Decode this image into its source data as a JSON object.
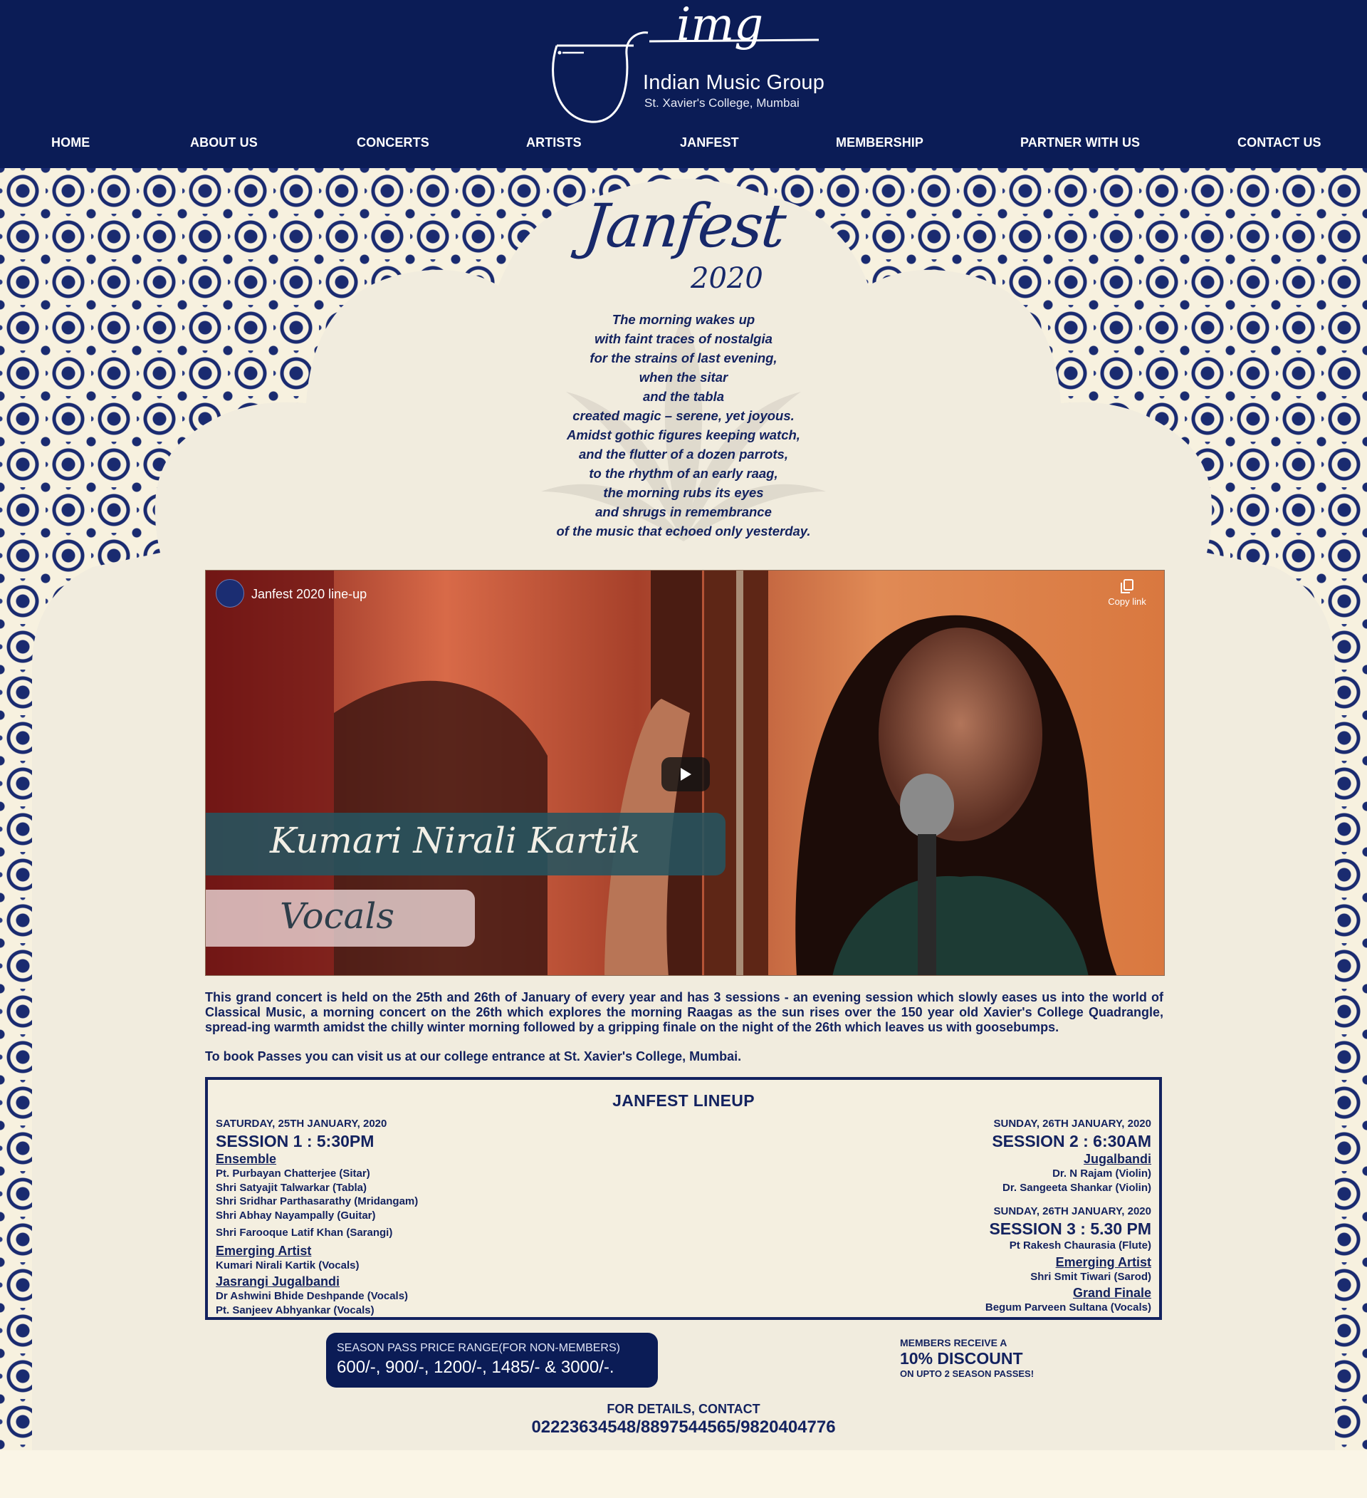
{
  "site": {
    "logo_mark": "img",
    "logo_title": "Indian Music Group",
    "logo_subtitle": "St. Xavier's College, Mumbai"
  },
  "nav": {
    "items": [
      {
        "label": "HOME"
      },
      {
        "label": "ABOUT US"
      },
      {
        "label": "CONCERTS"
      },
      {
        "label": "ARTISTS"
      },
      {
        "label": "JANFEST"
      },
      {
        "label": "MEMBERSHIP"
      },
      {
        "label": "PARTNER WITH US"
      },
      {
        "label": "CONTACT US"
      }
    ]
  },
  "hero": {
    "title": "Janfest",
    "year": "2020",
    "poem": [
      "The morning wakes up",
      "with faint traces of nostalgia",
      "for the strains of last evening,",
      "when the sitar",
      "and the tabla",
      "created magic – serene, yet joyous.",
      "Amidst gothic figures keeping watch,",
      "and the flutter of a dozen parrots,",
      "to the rhythm of an early raag,",
      "the morning rubs its eyes",
      "and shrugs in remembrance",
      "of the music that echoed only yesterday."
    ]
  },
  "video": {
    "title": "Janfest 2020 line-up",
    "copy_link_label": "Copy link",
    "overlay_name": "Kumari Nirali Kartik",
    "overlay_role": "Vocals",
    "play_icon": "play-icon",
    "copy_icon": "copy-icon"
  },
  "description": {
    "text": "This grand concert is held on the 25th and 26th of January of every year and has 3 sessions - an evening session which slowly eases us into the world of Classical Music, a morning concert on the 26th which explores the morning Raagas as the sun rises over the 150 year old Xavier's College Quadrangle, spread-ing warmth amidst the chilly winter morning followed by a gripping finale on the night of the 26th which leaves us with goosebumps.",
    "booking": "To book Passes you can visit us at our college entrance at St. Xavier's College, Mumbai."
  },
  "lineup": {
    "heading": "JANFEST LINEUP",
    "session1": {
      "date": "SATURDAY, 25TH JANUARY, 2020",
      "title": "SESSION 1 : 5:30PM",
      "group1": "Ensemble",
      "group1_artists": [
        "Pt. Purbayan Chatterjee (Sitar)",
        "Shri Satyajit Talwarkar (Tabla)",
        "Shri Sridhar Parthasarathy (Mridangam)",
        "Shri Abhay Nayampally (Guitar)",
        "Shri Farooque Latif Khan (Sarangi)"
      ],
      "group2": "Emerging Artist",
      "group2_artists": [
        "Kumari Nirali Kartik (Vocals)"
      ],
      "group3": "Jasrangi Jugalbandi",
      "group3_artists": [
        "Dr Ashwini Bhide Deshpande (Vocals)",
        "Pt. Sanjeev Abhyankar (Vocals)"
      ]
    },
    "session2": {
      "date": "SUNDAY, 26TH JANUARY, 2020",
      "title": "SESSION 2 : 6:30AM",
      "group1": "Jugalbandi",
      "group1_artists": [
        "Dr. N Rajam (Violin)",
        "Dr. Sangeeta Shankar (Violin)"
      ]
    },
    "session3": {
      "date": "SUNDAY, 26TH JANUARY, 2020",
      "title": "SESSION 3 : 5.30 PM",
      "headliner": "Pt Rakesh Chaurasia (Flute)",
      "group1": "Emerging Artist",
      "group1_artists": [
        "Shri Smit Tiwari (Sarod)"
      ],
      "group2": "Grand Finale",
      "group2_artists": [
        "Begum Parveen Sultana (Vocals)"
      ]
    }
  },
  "pricing": {
    "label": "SEASON PASS PRICE RANGE(FOR NON-MEMBERS)",
    "values": "600/-, 900/-, 1200/-, 1485/- & 3000/-."
  },
  "discount": {
    "top": "MEMBERS RECEIVE A",
    "main": "10% DISCOUNT",
    "bottom": "ON UPTO 2 SEASON PASSES!"
  },
  "contact": {
    "label": "FOR DETAILS, CONTACT",
    "phones": "02223634548/8897544565/9820404776"
  },
  "colors": {
    "navy": "#0b1c56",
    "text": "#13225f",
    "cream": "#f4efe0"
  }
}
